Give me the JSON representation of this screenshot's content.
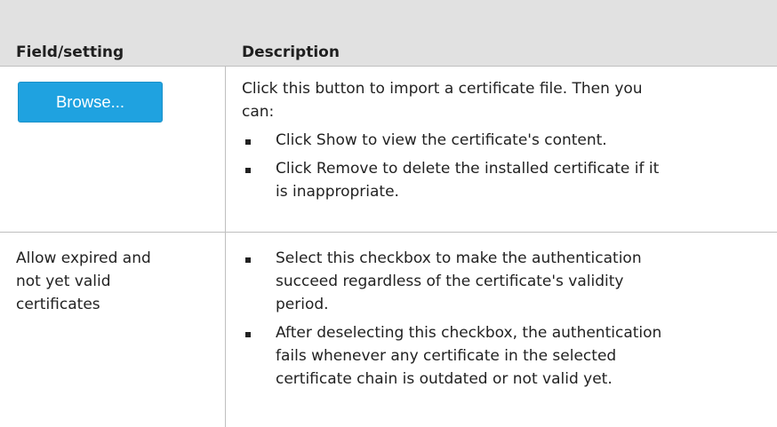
{
  "table": {
    "headers": {
      "field": "Field/setting",
      "description": "Description"
    },
    "rows": [
      {
        "field_button": "Browse...",
        "description_intro": [
          "Click this button to import a certificate file. Then you",
          "can:"
        ],
        "bullets": [
          [
            "Click Show to view the certificate's content."
          ],
          [
            "Click Remove to delete the installed certificate if it",
            "is inappropriate."
          ]
        ]
      },
      {
        "field_text": [
          "Allow expired and",
          "not yet valid",
          "certificates"
        ],
        "bullets": [
          [
            "Select this checkbox to make the authentication",
            "succeed regardless of the certificate's validity",
            "period."
          ],
          [
            "After deselecting this checkbox, the authentication",
            "fails whenever any certificate in the selected",
            "certificate chain is outdated or not valid yet."
          ]
        ]
      }
    ]
  }
}
